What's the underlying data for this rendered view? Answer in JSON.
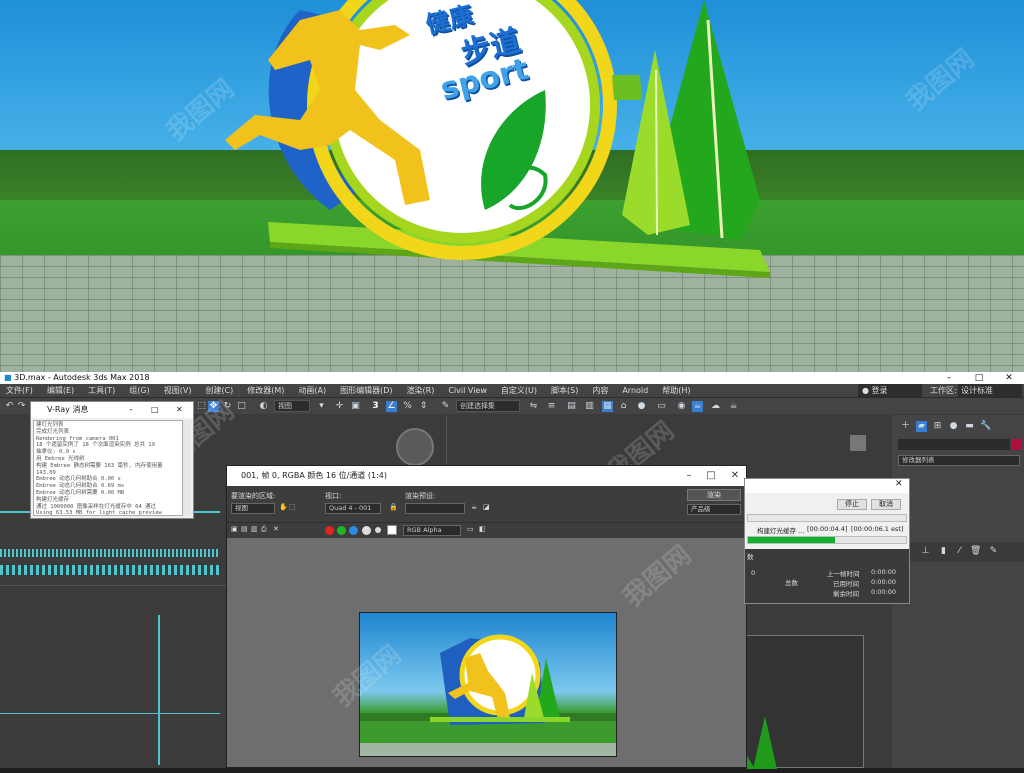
{
  "colors": {
    "accent": "#0fb12a",
    "cyan": "#4cc7d0",
    "ui_dark": "#3a3a3a",
    "render_green": "#2e8b25",
    "sky_blue": "#1f8fd8"
  },
  "poster": {
    "sign_line1": "健康",
    "sign_line2": "步道",
    "sign_line3": "sport"
  },
  "watermark": "我图网",
  "window": {
    "title": "3D.max - Autodesk 3ds Max 2018",
    "minimize": "–",
    "maximize": "□",
    "close": "✕"
  },
  "menu": {
    "items": [
      "文件(F)",
      "编辑(E)",
      "工具(T)",
      "组(G)",
      "视图(V)",
      "创建(C)",
      "修改器(M)",
      "动画(A)",
      "图形编辑器(D)",
      "渲染(R)",
      "Civil View",
      "自定义(U)",
      "脚本(S)",
      "内容",
      "Arnold",
      "帮助(H)"
    ],
    "login": "登录",
    "workspace_label": "工作区:",
    "workspace_value": "设计标准"
  },
  "toolbar": {
    "view_dropdown": "视图",
    "selection_set": "创建选择集",
    "snap_value": "3"
  },
  "command_panel": {
    "modifier_list": "修改器列表"
  },
  "vray_log": {
    "title": "V-Ray 消息",
    "lines": [
      "建灯光列表",
      "完成灯光列表",
      "Rendering from camera 001",
      "18 个遗留实例了 18 个次面渲染实例 总共 19",
      "抽拿仪: 0.0 s",
      "用 Embree 光线树",
      "构建 Embree 静态树需要 163 毫秒, 内存使用量 143.09",
      "Embree 动态几何树助合 0.00 s",
      "Embree 动态几何树助合 0.69 ms",
      "Embree 动态几何树需要 0.00 MB",
      "构建灯光缓存",
      "通过 1000000 图像采样在灯光缓存中 64 通过",
      "Using 63.53 MB for light cache preview buffer"
    ]
  },
  "frame_buffer": {
    "title": "001, 帧 0, RGBA 颜色 16 位/通道 (1:4)",
    "area_label": "要渲染的区域:",
    "area_value": "视图",
    "viewport_label": "视口:",
    "viewport_value": "Quad 4 - 001",
    "preset_label": "渲染预设:",
    "preset_value": "",
    "render_button": "渲染",
    "quality_value": "产品级",
    "channel_value": "RGB Alpha"
  },
  "progress": {
    "stop_button": "停止",
    "cancel_button": "取消",
    "task": "构建灯光缓存 ...",
    "time_elapsed": "[00:00:04.4]",
    "time_total": "[00:00:06.1 est]",
    "fraction": 0.55,
    "section_label": "数",
    "frame_label": "0",
    "total_label": "总数",
    "last_frame_label": "上一帧时间",
    "last_frame_value": "0:00:00",
    "elapsed_label": "已用时间",
    "elapsed_value": "0:00:00",
    "remaining_label": "剩余时间",
    "remaining_value": "0:00:00"
  }
}
